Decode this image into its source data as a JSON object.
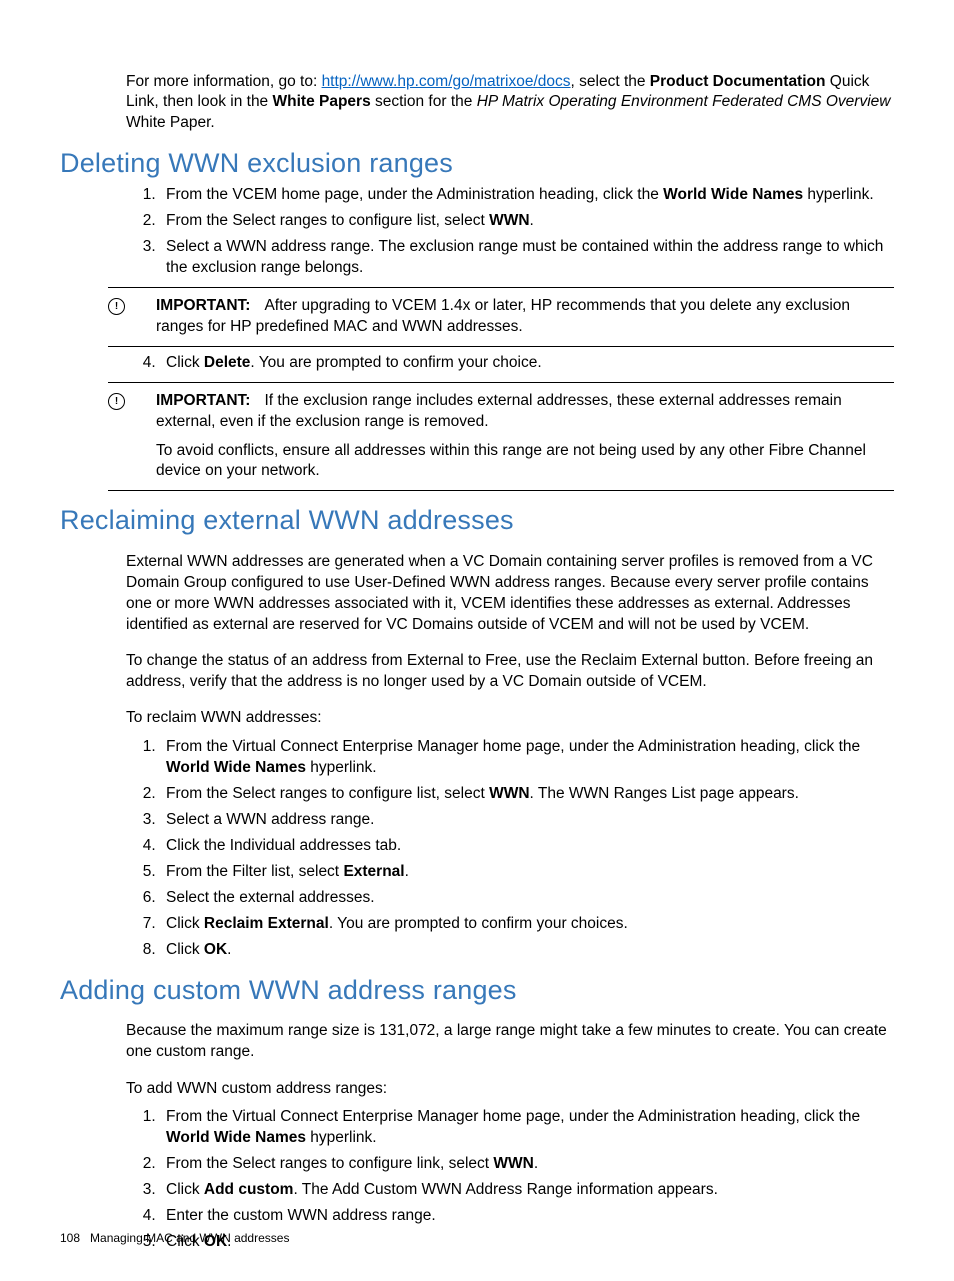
{
  "intro": {
    "pre": "For more information, go to: ",
    "link_text": "http://www.hp.com/go/matrixoe/docs",
    "mid1": ", select the ",
    "b1": "Product Documentation",
    "mid2": " Quick Link, then look in the ",
    "b2": "White Papers",
    "mid3": " section for the ",
    "i1": "HP Matrix Operating Environment Federated CMS Overview",
    "tail": " White Paper."
  },
  "s1": {
    "heading": "Deleting WWN exclusion ranges",
    "steps_a": {
      "1": {
        "pre": "From the VCEM home page, under the Administration heading, click the ",
        "b": "World Wide Names",
        "post": " hyperlink."
      },
      "2": {
        "pre": "From the Select ranges to configure list, select ",
        "b": "WWN",
        "post": "."
      },
      "3": {
        "text": "Select a WWN address range. The exclusion range must be contained within the address range to which the exclusion range belongs."
      }
    },
    "imp1": {
      "label": "IMPORTANT:",
      "text": "After upgrading to VCEM 1.4x or later, HP recommends that you delete any exclusion ranges for HP predefined MAC and WWN addresses."
    },
    "steps_b": {
      "4": {
        "pre": "Click ",
        "b": "Delete",
        "post": ". You are prompted to confirm your choice."
      }
    },
    "imp2": {
      "label": "IMPORTANT:",
      "p1": "If the exclusion range includes external addresses, these external addresses remain external, even if the exclusion range is removed.",
      "p2": "To avoid conflicts, ensure all addresses within this range are not being used by any other Fibre Channel device on your network."
    }
  },
  "s2": {
    "heading": "Reclaiming external WWN addresses",
    "p1": "External WWN addresses are generated when a VC Domain containing server profiles is removed from a VC Domain Group configured to use User-Defined WWN address ranges. Because every server profile contains one or more WWN addresses associated with it, VCEM identifies these addresses as external. Addresses identified as external are reserved for VC Domains outside of VCEM and will not be used by VCEM.",
    "p2": "To change the status of an address from External to Free, use the Reclaim External button. Before freeing an address, verify that the address is no longer used by a VC Domain outside of VCEM.",
    "p3": "To reclaim WWN addresses:",
    "steps": {
      "1": {
        "pre": "From the Virtual Connect Enterprise Manager home page, under the Administration heading, click the ",
        "b": "World Wide Names",
        "post": " hyperlink."
      },
      "2": {
        "pre": "From the Select ranges to configure list, select ",
        "b": "WWN",
        "post": ". The WWN Ranges List page appears."
      },
      "3": {
        "text": "Select a WWN address range."
      },
      "4": {
        "text": "Click the Individual addresses tab."
      },
      "5": {
        "pre": "From the Filter list, select ",
        "b": "External",
        "post": "."
      },
      "6": {
        "text": "Select the external addresses."
      },
      "7": {
        "pre": "Click ",
        "b": "Reclaim External",
        "post": ". You are prompted to confirm your choices."
      },
      "8": {
        "pre": "Click ",
        "b": "OK",
        "post": "."
      }
    }
  },
  "s3": {
    "heading": "Adding custom WWN address ranges",
    "p1": "Because the maximum range size is 131,072, a large range might take a few minutes to create. You can create one custom range.",
    "p2": "To add WWN custom address ranges:",
    "steps": {
      "1": {
        "pre": "From the Virtual Connect Enterprise Manager home page, under the Administration heading, click the ",
        "b": "World Wide Names",
        "post": " hyperlink."
      },
      "2": {
        "pre": "From the Select ranges to configure link, select ",
        "b": "WWN",
        "post": "."
      },
      "3": {
        "pre": "Click ",
        "b": "Add custom",
        "post": ". The Add Custom WWN Address Range information appears."
      },
      "4": {
        "text": "Enter the custom WWN address range."
      },
      "5": {
        "pre": "Click ",
        "b": "OK",
        "post": "."
      }
    }
  },
  "footer": {
    "page": "108",
    "title": "Managing MAC and WWN addresses"
  },
  "icon_char": "!"
}
